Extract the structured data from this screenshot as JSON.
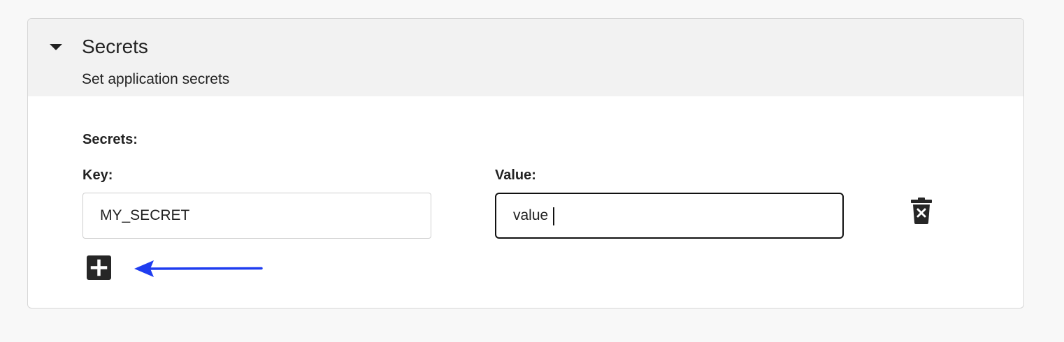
{
  "section": {
    "title": "Secrets",
    "subtitle": "Set application secrets",
    "icons": {
      "toggle": "caret-down-icon",
      "delete": "trash-icon",
      "add": "plus-square-icon",
      "annotation": "arrow-left-icon"
    }
  },
  "secrets": {
    "label": "Secrets:",
    "key_label": "Key:",
    "value_label": "Value:",
    "rows": [
      {
        "key": "MY_SECRET",
        "value": "value "
      }
    ]
  },
  "colors": {
    "annotation_arrow": "#1f3df0",
    "header_bg": "#f2f2f2",
    "button_bg": "#262626"
  }
}
